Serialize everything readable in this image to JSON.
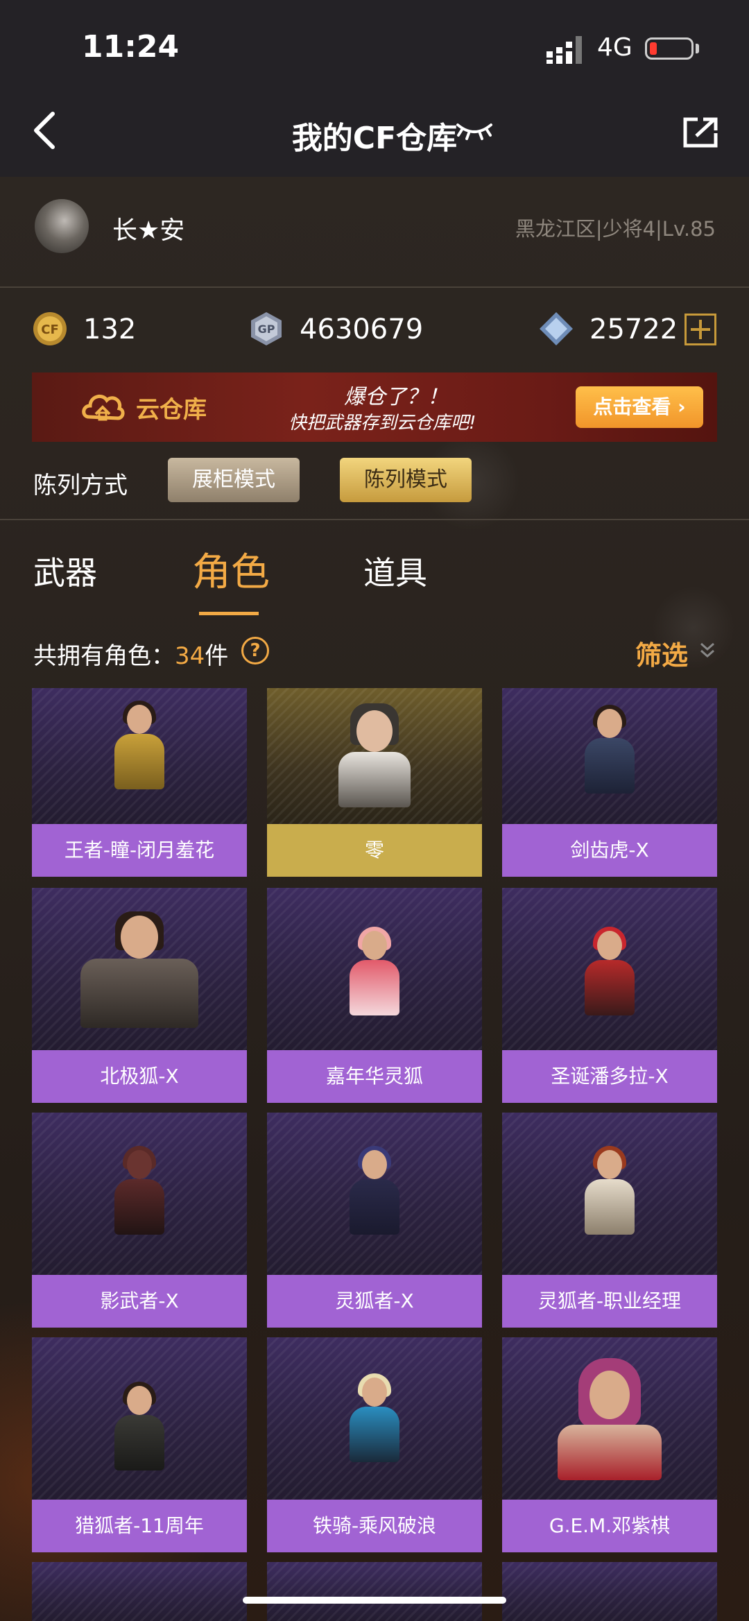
{
  "status_bar": {
    "time": "11:24",
    "network": "4G"
  },
  "header": {
    "title": "我的CF仓库"
  },
  "profile": {
    "nickname": "长★安",
    "region_rank_level": "黑龙江区|少将4|Lv.85"
  },
  "currencies": [
    {
      "icon": "cf-coin-icon",
      "value": "132"
    },
    {
      "icon": "gp-coin-icon",
      "value": "4630679"
    },
    {
      "icon": "diamond-icon",
      "value": "25722"
    }
  ],
  "banner": {
    "label": "云仓库",
    "slogan_line1": "爆仓了？！",
    "slogan_line2": "快把武器存到云仓库吧!",
    "button": "点击查看 ›"
  },
  "display_mode": {
    "label": "陈列方式",
    "options": [
      "展柜模式",
      "陈列模式"
    ],
    "selected": "陈列模式"
  },
  "tabs": [
    {
      "label": "武器",
      "active": false
    },
    {
      "label": "角色",
      "active": true
    },
    {
      "label": "道具",
      "active": false
    }
  ],
  "count": {
    "prefix": "共拥有角色：",
    "number": "34",
    "suffix": "件"
  },
  "filter": {
    "label": "筛选"
  },
  "characters": [
    {
      "name": "王者-瞳-闭月羞花",
      "rarity": "purple"
    },
    {
      "name": "零",
      "rarity": "gold"
    },
    {
      "name": "剑齿虎-X",
      "rarity": "purple"
    },
    {
      "name": "北极狐-X",
      "rarity": "purple"
    },
    {
      "name": "嘉年华灵狐",
      "rarity": "purple"
    },
    {
      "name": "圣诞潘多拉-X",
      "rarity": "purple"
    },
    {
      "name": "影武者-X",
      "rarity": "purple"
    },
    {
      "name": "灵狐者-X",
      "rarity": "purple"
    },
    {
      "name": "灵狐者-职业经理",
      "rarity": "purple"
    },
    {
      "name": "猎狐者-11周年",
      "rarity": "purple"
    },
    {
      "name": "铁骑-乘风破浪",
      "rarity": "purple"
    },
    {
      "name": "G.E.M.邓紫棋",
      "rarity": "purple"
    }
  ],
  "colors": {
    "accent": "#f3aa45",
    "purple_label": "#a163d3",
    "gold_label": "#c9ad4d"
  }
}
